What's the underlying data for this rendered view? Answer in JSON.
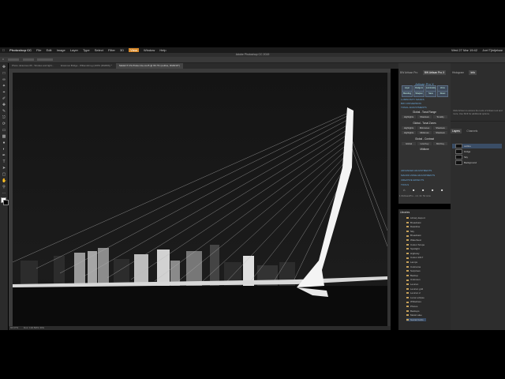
{
  "menubar": {
    "apple": "",
    "items": [
      "Photoshop CC",
      "File",
      "Edit",
      "Image",
      "Layer",
      "Type",
      "Select",
      "Filter",
      "3D",
      "View",
      "Window",
      "Help"
    ],
    "highlighted": "View",
    "clock": "Wed 27 Mar  19:42",
    "user": "Joel Tjintjelaar"
  },
  "window_title": "Adobe Photoshop CC 2019",
  "tabs": [
    {
      "label": "Photo -Erasmus 06 - Strokes and light..."
    },
    {
      "label": "Erasmus Bridge - Willemsbrug (100% (RGB/8)) *"
    },
    {
      "label": "SELECT-VS-Plotter-bw-msr5 @ 66.7% (outline, RGB/16*)"
    }
  ],
  "statusbar": {
    "zoom": "66.67%",
    "doc": "Doc: 102.5M/1.30G"
  },
  "panel_mid": {
    "tabs": [
      "BW Artisan Pro",
      "BW Artisan Pro X"
    ],
    "heading": "Artisan Pro X",
    "buttons": [
      "Layer Opacity",
      "Dodge & Burn",
      "Luminosity Masks",
      "Zone Masks",
      "Blending",
      "Sharpen",
      "Save",
      "Reset"
    ],
    "sections": [
      "LUMINOSITY MASKS",
      "BW CONVERSION",
      "TONAL ADJUSTMENTS",
      "ADVANCED ADJUSTMENTS",
      "MACRO ZONE ADJUSTMENTS",
      "CREATIVE EFFECTS",
      "TOOLS"
    ],
    "global_tonal": {
      "title": "Global - Tonal Range",
      "buttons": [
        "Highlights",
        "Shadows",
        "Tonality"
      ]
    },
    "global_zones": {
      "title": "Global - Tonal Zones",
      "buttons": [
        "Highlights",
        "Mid-tones",
        "Shadows",
        "Highlights",
        "Midtones",
        "Shadows"
      ]
    },
    "global_contrast": {
      "title": "Global - Contrast",
      "buttons": [
        "Global",
        "Low Key",
        "Mid Key"
      ]
    },
    "midtone_label": "Midtone",
    "footer": "1 #Artisan/Pro - n.b. Dr. 54 mins"
  },
  "panel_right": {
    "tabs": [
      "Histogram",
      "Info"
    ],
    "info_text": "Click Artisan to access the tools of Artisan tool and more. Use Shift for additional options.",
    "layers_tabs": [
      "Layers",
      "Channels"
    ],
    "layers": [
      "outline",
      "bridge",
      "Sky",
      "Background"
    ],
    "selected_layer": "outline"
  },
  "libraries": {
    "title": "Libraries",
    "items": [
      "Library Export",
      "Broadcast",
      "Dawnline",
      "Sky",
      "Broadcast",
      "Waterbeat",
      "Colour Scope",
      "Spotlight",
      "Highway",
      "Colour 2017",
      "Lamps",
      "Colorama",
      "Surprises",
      "Backup",
      "Unknown",
      "Lexicon",
      "Lexicon grid",
      "Lexicon 2",
      "Lunar eclipse",
      "Whitelines",
      "Photos",
      "Backups",
      "Metal Lake",
      "Social Kurtis"
    ]
  },
  "colors": {
    "accent": "#6aa7d8",
    "highlight_menu": "#d98a2a",
    "selected_layer": "#3a4d66"
  }
}
